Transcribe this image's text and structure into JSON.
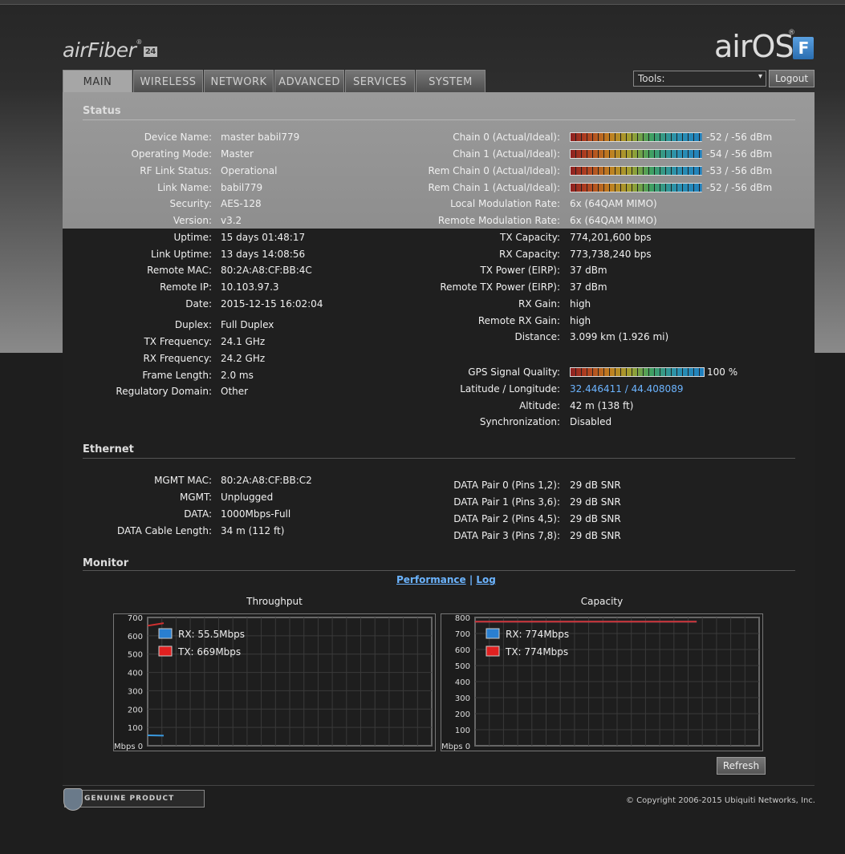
{
  "brand": {
    "left_logo": "airFiber",
    "left_badge": "24",
    "right_logo": "airOS",
    "right_badge": "F"
  },
  "tabs": [
    {
      "label": "MAIN",
      "active": true
    },
    {
      "label": "WIRELESS"
    },
    {
      "label": "NETWORK"
    },
    {
      "label": "ADVANCED"
    },
    {
      "label": "SERVICES"
    },
    {
      "label": "SYSTEM"
    }
  ],
  "toolbar": {
    "tools_label": "Tools:",
    "logout_label": "Logout"
  },
  "status": {
    "title": "Status",
    "left": [
      {
        "label": "Device Name:",
        "value": "master babil779"
      },
      {
        "label": "Operating Mode:",
        "value": "Master"
      },
      {
        "label": "RF Link Status:",
        "value": "Operational"
      },
      {
        "label": "Link Name:",
        "value": "babil779"
      },
      {
        "label": "Security:",
        "value": "AES-128"
      },
      {
        "label": "Version:",
        "value": "v3.2"
      },
      {
        "label": "Uptime:",
        "value": "15 days 01:48:17"
      },
      {
        "label": "Link Uptime:",
        "value": "13 days 14:08:56"
      },
      {
        "label": "Remote MAC:",
        "value": "80:2A:A8:CF:BB:4C"
      },
      {
        "label": "Remote IP:",
        "value": "10.103.97.3"
      },
      {
        "label": "Date:",
        "value": "2015-12-15 16:02:04"
      }
    ],
    "left2": [
      {
        "label": "Duplex:",
        "value": "Full Duplex"
      },
      {
        "label": "TX Frequency:",
        "value": "24.1 GHz"
      },
      {
        "label": "RX Frequency:",
        "value": "24.2 GHz"
      },
      {
        "label": "Frame Length:",
        "value": "2.0 ms"
      },
      {
        "label": "Regulatory Domain:",
        "value": "Other"
      }
    ],
    "right_meters": [
      {
        "label": "Chain 0 (Actual/Ideal):",
        "value": "-52 / -56 dBm",
        "level": 0.98
      },
      {
        "label": "Chain 1 (Actual/Ideal):",
        "value": "-54 / -56 dBm",
        "level": 0.98
      },
      {
        "label": "Rem Chain 0 (Actual/Ideal):",
        "value": "-53 / -56 dBm",
        "level": 0.98
      },
      {
        "label": "Rem Chain 1 (Actual/Ideal):",
        "value": "-52 / -56 dBm",
        "level": 0.98
      }
    ],
    "right": [
      {
        "label": "Local Modulation Rate:",
        "value": "6x (64QAM MIMO)"
      },
      {
        "label": "Remote Modulation Rate:",
        "value": "6x (64QAM MIMO)"
      },
      {
        "label": "TX Capacity:",
        "value": "774,201,600 bps"
      },
      {
        "label": "RX Capacity:",
        "value": "773,738,240 bps"
      },
      {
        "label": "TX Power (EIRP):",
        "value": "37 dBm"
      },
      {
        "label": "Remote TX Power (EIRP):",
        "value": "37 dBm"
      },
      {
        "label": "RX Gain:",
        "value": "high"
      },
      {
        "label": "Remote RX Gain:",
        "value": "high"
      },
      {
        "label": "Distance:",
        "value": "3.099 km (1.926 mi)"
      }
    ],
    "gps": {
      "label": "GPS Signal Quality:",
      "value": "100 %",
      "level": 1.0
    },
    "right2": [
      {
        "label": "Latitude / Longitude:",
        "value": "32.446411 / 44.408089",
        "link": true
      },
      {
        "label": "Altitude:",
        "value": "42 m (138 ft)"
      },
      {
        "label": "Synchronization:",
        "value": "Disabled"
      }
    ]
  },
  "ethernet": {
    "title": "Ethernet",
    "left": [
      {
        "label": "MGMT MAC:",
        "value": "80:2A:A8:CF:BB:C2"
      },
      {
        "label": "MGMT:",
        "value": "Unplugged"
      },
      {
        "label": "DATA:",
        "value": "1000Mbps-Full"
      },
      {
        "label": "DATA Cable Length:",
        "value": "34 m (112 ft)"
      }
    ],
    "right": [
      {
        "label": "DATA Pair 0 (Pins 1,2):",
        "value": "29 dB SNR"
      },
      {
        "label": "DATA Pair 1 (Pins 3,6):",
        "value": "29 dB SNR"
      },
      {
        "label": "DATA Pair 2 (Pins 4,5):",
        "value": "29 dB SNR"
      },
      {
        "label": "DATA Pair 3 (Pins 7,8):",
        "value": "29 dB SNR"
      }
    ]
  },
  "monitor": {
    "title": "Monitor",
    "link_performance": "Performance",
    "link_sep": " | ",
    "link_log": "Log",
    "refresh_label": "Refresh"
  },
  "chart_data": [
    {
      "type": "line",
      "title": "Throughput",
      "y_ticks": [
        0,
        100,
        200,
        300,
        400,
        500,
        600,
        700
      ],
      "ylim": [
        0,
        700
      ],
      "unit_label": "Mbps 0",
      "series": [
        {
          "name": "RX: 55.5Mbps",
          "color": "#2a7fd0",
          "values": [
            57,
            55
          ]
        },
        {
          "name": "TX: 669Mbps",
          "color": "#e02020",
          "values": [
            655,
            669
          ]
        }
      ]
    },
    {
      "type": "line",
      "title": "Capacity",
      "y_ticks": [
        0,
        100,
        200,
        300,
        400,
        500,
        600,
        700,
        800
      ],
      "ylim": [
        0,
        800
      ],
      "unit_label": "Mbps 0",
      "series": [
        {
          "name": "RX: 774Mbps",
          "color": "#2a7fd0",
          "values": [
            774,
            774
          ]
        },
        {
          "name": "TX: 774Mbps",
          "color": "#e02020",
          "values": [
            774,
            774
          ]
        }
      ]
    }
  ],
  "footer": {
    "genuine": "GENUINE PRODUCT",
    "copyright": "© Copyright 2006-2015 Ubiquiti Networks, Inc."
  }
}
